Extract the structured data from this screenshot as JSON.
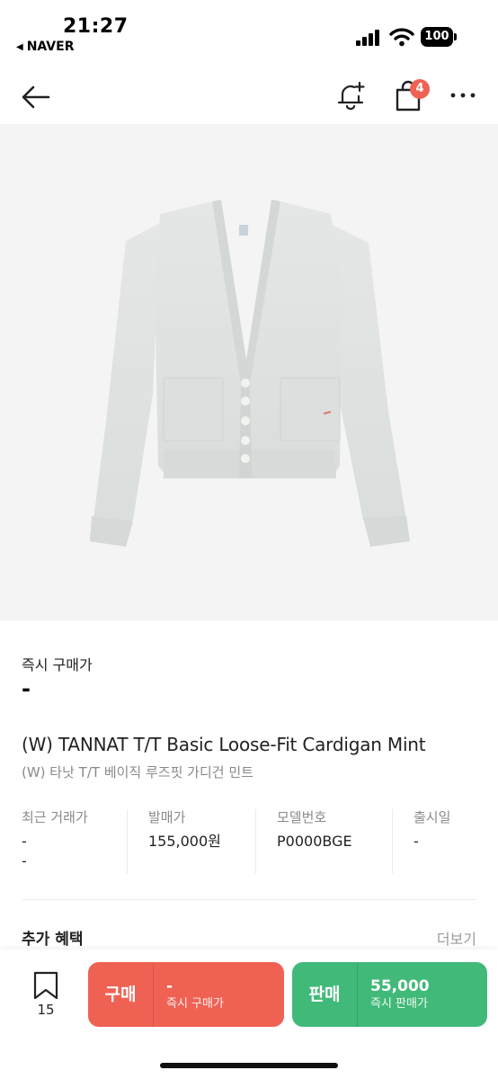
{
  "status_bar": {
    "time": "21:27",
    "back_app": "NAVER",
    "battery": "100"
  },
  "nav": {
    "cart_badge": "4"
  },
  "product": {
    "price_label": "즉시 구매가",
    "price_value": "-",
    "title_en": "(W) TANNAT T/T Basic Loose-Fit Cardigan Mint",
    "title_ko": "(W) 타낫 T/T 베이직 루즈핏 가디건 민트"
  },
  "info": [
    {
      "label": "최근 거래가",
      "value": "-",
      "value2": "-"
    },
    {
      "label": "발매가",
      "value": "155,000원"
    },
    {
      "label": "모델번호",
      "value": "P0000BGE"
    },
    {
      "label": "출시일",
      "value": "-"
    }
  ],
  "benefits": {
    "title": "추가 혜택",
    "more": "더보기"
  },
  "bottom": {
    "bookmark_count": "15",
    "buy": {
      "kind": "구매",
      "amount": "-",
      "sub": "즉시 구매가"
    },
    "sell": {
      "kind": "판매",
      "amount": "55,000",
      "sub": "즉시 판매가"
    }
  },
  "colors": {
    "buy": "#ef6253",
    "sell": "#41b979",
    "image_bg": "#f4f4f4"
  }
}
